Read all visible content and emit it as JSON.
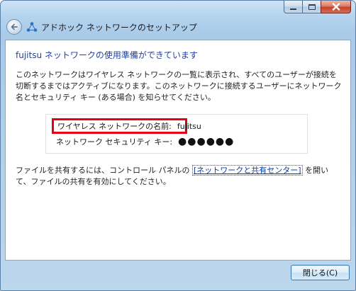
{
  "window": {
    "title": "アドホック ネットワークのセットアップ"
  },
  "content": {
    "heading": "fujitsu ネットワークの使用準備ができています",
    "description": "このネットワークはワイヤレス ネットワークの一覧に表示され、すべてのユーザーが接続を切断するまではアクティブになります。このネットワークに接続するユーザーにネットワーク名とセキュリティ キー (ある場合) を知らせてください。",
    "network_name_label": "ワイヤレス ネットワークの名前:",
    "network_name_value": "fujitsu",
    "security_key_label": "ネットワーク セキュリティ キー:",
    "security_key_value": "●●●●●●",
    "share_before": "ファイルを共有するには、コントロール パネルの",
    "share_link": "[ネットワークと共有センター]",
    "share_after": " を開いて、ファイルの共有を有効にしてください。"
  },
  "buttons": {
    "close": "閉じる(C)"
  },
  "colors": {
    "heading": "#1f3fa3",
    "highlight_border": "#e60012",
    "link": "#0b3ea3"
  },
  "icons": {
    "back": "back-arrow-icon",
    "network": "network-icon",
    "minimize": "minimize-icon",
    "maximize": "maximize-icon",
    "close": "close-icon"
  }
}
